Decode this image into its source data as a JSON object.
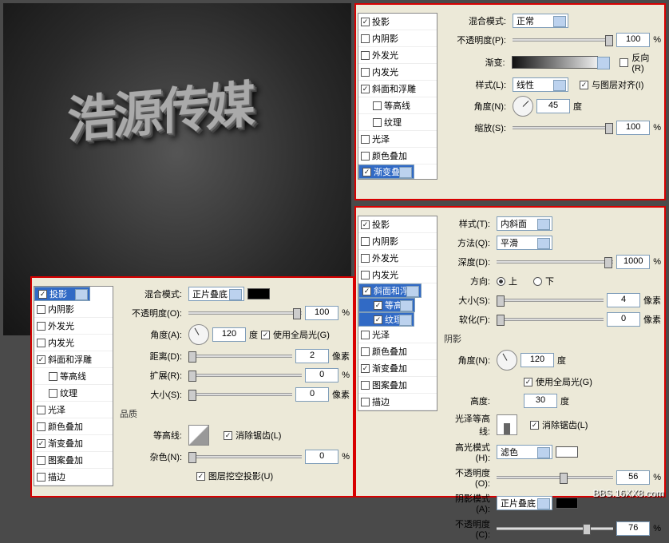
{
  "preview": {
    "text": "浩源传媒"
  },
  "common": {
    "fx": {
      "drop_shadow": "投影",
      "inner_shadow": "内阴影",
      "outer_glow": "外发光",
      "inner_glow": "内发光",
      "bevel": "斜面和浮雕",
      "contour": "等高线",
      "texture": "纹理",
      "satin": "光泽",
      "color_overlay": "颜色叠加",
      "gradient_overlay": "渐变叠加",
      "pattern_overlay": "图案叠加",
      "stroke": "描边"
    },
    "units": {
      "percent": "%",
      "px": "像素",
      "deg": "度"
    }
  },
  "panel_a": {
    "labels": {
      "blend_mode": "混合模式:",
      "opacity": "不透明度(P):",
      "gradient": "渐变:",
      "reverse": "反向(R)",
      "style": "样式(L):",
      "align": "与图层对齐(I)",
      "angle": "角度(N):",
      "scale": "缩放(S):"
    },
    "values": {
      "blend_mode": "正常",
      "opacity": "100",
      "style": "线性",
      "angle": "45",
      "scale": "100"
    }
  },
  "panel_b": {
    "labels": {
      "blend_mode": "混合模式:",
      "opacity": "不透明度(O):",
      "angle": "角度(A):",
      "global": "使用全局光(G)",
      "distance": "距离(D):",
      "spread": "扩展(R):",
      "size": "大小(S):",
      "quality": "品质",
      "contour": "等高线:",
      "antialias": "消除锯齿(L)",
      "noise": "杂色(N):",
      "knockout": "图层挖空投影(U)"
    },
    "values": {
      "blend_mode": "正片叠底",
      "opacity": "100",
      "angle": "120",
      "distance": "2",
      "spread": "0",
      "size": "0",
      "noise": "0"
    }
  },
  "panel_c": {
    "labels": {
      "style": "样式(T):",
      "technique": "方法(Q):",
      "depth": "深度(D):",
      "direction": "方向:",
      "up": "上",
      "down": "下",
      "size": "大小(S):",
      "soften": "软化(F):",
      "shading": "阴影",
      "angle": "角度(N):",
      "global": "使用全局光(G)",
      "altitude": "高度:",
      "gloss_contour": "光泽等高线:",
      "antialias": "消除锯齿(L)",
      "highlight_mode": "高光模式(H):",
      "hl_opacity": "不透明度(O):",
      "shadow_mode": "阴影模式(A):",
      "sh_opacity": "不透明度(C):"
    },
    "values": {
      "style": "内斜面",
      "technique": "平滑",
      "depth": "1000",
      "size": "4",
      "soften": "0",
      "angle": "120",
      "altitude": "30",
      "highlight_mode": "滤色",
      "hl_opacity": "56",
      "shadow_mode": "正片叠底",
      "sh_opacity": "76"
    }
  },
  "watermark": "BBS.16XX8.com"
}
